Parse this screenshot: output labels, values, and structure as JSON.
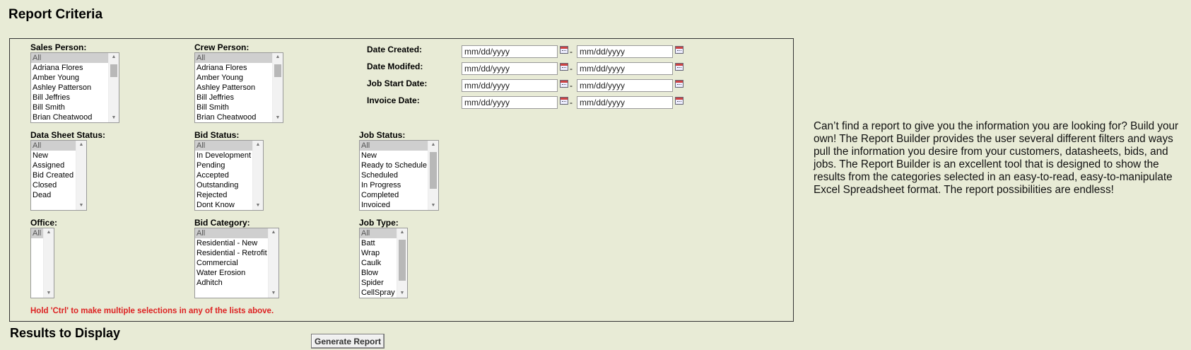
{
  "page": {
    "title": "Report Criteria",
    "hint": "Hold 'Ctrl' to make multiple selections in any of the lists above.",
    "results_title": "Results to Display",
    "generate_label": "Generate Report",
    "info_text": "Can’t find a report to give you the information you are looking for? Build your own! The Report Builder provides the user several different filters and ways pull the information you desire from your customers, datasheets, bids, and jobs. The Report Builder is an excellent tool that is designed to show the results from the categories selected in an easy-to-read, easy-to-manipulate Excel Spreadsheet format. The report possibilities are endless!"
  },
  "lists": {
    "sales_person": {
      "label": "Sales Person:",
      "options": [
        "All",
        "Adriana Flores",
        "Amber Young",
        "Ashley Patterson",
        "Bill Jeffries",
        "Bill Smith",
        "Brian Cheatwood"
      ]
    },
    "crew_person": {
      "label": "Crew Person:",
      "options": [
        "All",
        "Adriana Flores",
        "Amber Young",
        "Ashley Patterson",
        "Bill Jeffries",
        "Bill Smith",
        "Brian Cheatwood"
      ]
    },
    "data_sheet_status": {
      "label": "Data Sheet Status:",
      "options": [
        "All",
        "New",
        "Assigned",
        "Bid Created",
        "Closed",
        "Dead"
      ]
    },
    "bid_status": {
      "label": "Bid Status:",
      "options": [
        "All",
        "In Development",
        "Pending",
        "Accepted",
        "Outstanding",
        "Rejected",
        "Dont Know"
      ]
    },
    "job_status": {
      "label": "Job Status:",
      "options": [
        "All",
        "New",
        "Ready to Schedule",
        "Scheduled",
        "In Progress",
        "Completed",
        "Invoiced"
      ]
    },
    "office": {
      "label": "Office:",
      "options": [
        "All"
      ]
    },
    "bid_category": {
      "label": "Bid Category:",
      "options": [
        "All",
        "Residential - New",
        "Residential - Retrofit",
        "Commercial",
        "Water Erosion",
        "Adhitch"
      ]
    },
    "job_type": {
      "label": "Job Type:",
      "options": [
        "All",
        "Batt",
        "Wrap",
        "Caulk",
        "Blow",
        "Spider",
        "CellSpray"
      ]
    }
  },
  "dates": {
    "placeholder": "mm/dd/yyyy",
    "separator": "-",
    "rows": [
      {
        "label": "Date Created:"
      },
      {
        "label": "Date Modifed:"
      },
      {
        "label": "Job Start Date:"
      },
      {
        "label": "Invoice Date:"
      }
    ]
  }
}
